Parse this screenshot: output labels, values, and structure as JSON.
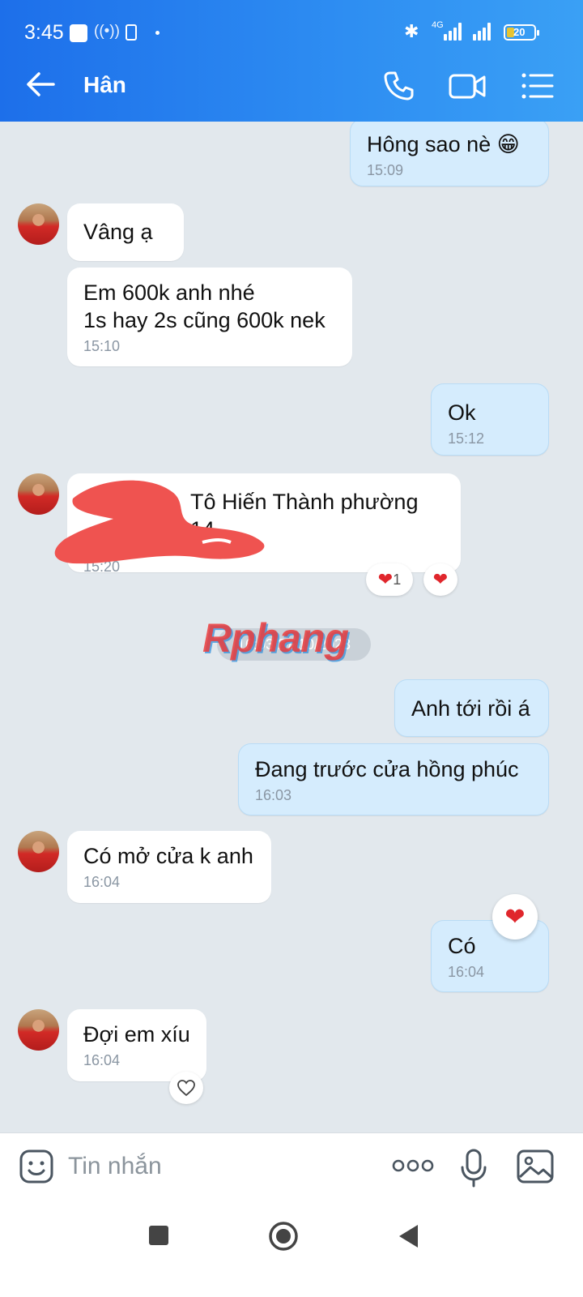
{
  "status_bar": {
    "time": "3:45",
    "network": "4G",
    "battery": "20"
  },
  "header": {
    "title": "Hân"
  },
  "messages": [
    {
      "text": "Hông sao nè 😁",
      "time": "15:09"
    },
    {
      "text": "Vâng ạ"
    },
    {
      "line1": "Em 600k anh nhé",
      "line2": "1s hay 2s cũng 600k nek",
      "time": "15:10"
    },
    {
      "text": "Ok",
      "time": "15:12"
    },
    {
      "text": "Tô Hiến Thành phường 14",
      "time": "15:20",
      "reaction_count": "1"
    },
    {
      "text": "Anh tới rồi á"
    },
    {
      "text": "Đang trước cửa hồng phúc",
      "time": "16:03"
    },
    {
      "text": "Có mở cửa k anh",
      "time": "16:04"
    },
    {
      "text": "Có",
      "time": "16:04"
    },
    {
      "text": "Đợi em xíu",
      "time": "16:04"
    }
  ],
  "date_separator": "16:03 27/10/2023",
  "watermark": "Rphang",
  "composer": {
    "placeholder": "Tin nhắn"
  },
  "icons": [
    "back-arrow-icon",
    "phone-icon",
    "video-icon",
    "menu-icon",
    "sticker-icon",
    "more-icon",
    "mic-icon",
    "image-icon",
    "heart-icon"
  ],
  "colors": {
    "header": "#2e8ef2",
    "outgoing_bubble": "#d5ecfd",
    "incoming_bubble": "#ffffff",
    "chat_bg": "#e2e8ed"
  }
}
